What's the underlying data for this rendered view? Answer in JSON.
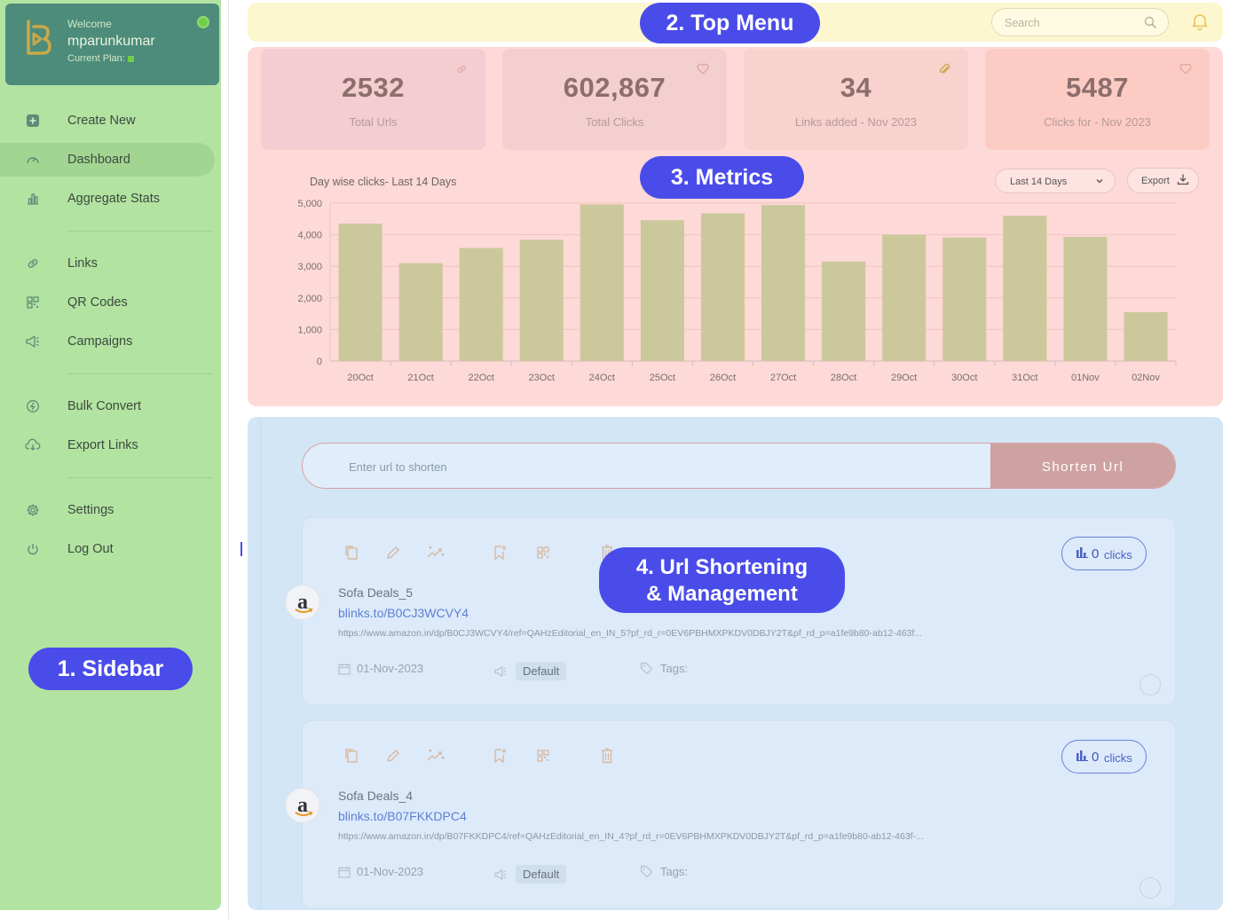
{
  "sidebar": {
    "welcome": "Welcome",
    "username": "mparunkumar",
    "plan_label": "Current Plan:",
    "items": [
      {
        "label": "Create New",
        "icon": "plus-square-icon"
      },
      {
        "label": "Dashboard",
        "icon": "dashboard-gauge-icon",
        "active": true
      },
      {
        "label": "Aggregate Stats",
        "icon": "bar-chart-icon"
      },
      {
        "label": "Links",
        "icon": "link-icon"
      },
      {
        "label": "QR Codes",
        "icon": "qr-code-icon"
      },
      {
        "label": "Campaigns",
        "icon": "megaphone-icon"
      },
      {
        "label": "Bulk Convert",
        "icon": "bulk-convert-icon"
      },
      {
        "label": "Export Links",
        "icon": "cloud-download-icon"
      },
      {
        "label": "Settings",
        "icon": "gear-icon"
      },
      {
        "label": "Log Out",
        "icon": "power-icon"
      }
    ]
  },
  "topbar": {
    "search_placeholder": "Search"
  },
  "stats": [
    {
      "value": "2532",
      "label": "Total Urls",
      "icon": "link-icon"
    },
    {
      "value": "602,867",
      "label": "Total Clicks",
      "icon": "heart-icon"
    },
    {
      "value": "34",
      "label": "Links added - Nov 2023",
      "icon": "paperclip-icon"
    },
    {
      "value": "5487",
      "label": "Clicks for - Nov 2023",
      "icon": "heart-icon"
    }
  ],
  "chart_controls": {
    "range": "Last 14 Days",
    "export": "Export"
  },
  "chart_data": {
    "type": "bar",
    "title": "Day wise clicks- Last 14 Days",
    "categories": [
      "20Oct",
      "21Oct",
      "22Oct",
      "23Oct",
      "24Oct",
      "25Oct",
      "26Oct",
      "27Oct",
      "28Oct",
      "29Oct",
      "30Oct",
      "31Oct",
      "01Nov",
      "02Nov"
    ],
    "values": [
      4350,
      3100,
      3580,
      3840,
      4960,
      4460,
      4680,
      4940,
      3150,
      4000,
      3910,
      4600,
      3930,
      1550
    ],
    "ylim": [
      0,
      5000
    ],
    "yticks": [
      "0",
      "1,000",
      "2,000",
      "3,000",
      "4,000",
      "5,000"
    ],
    "grid": true,
    "bar_color": "#cbc89b"
  },
  "shortener": {
    "placeholder": "Enter url to shorten",
    "button": "Shorten Url"
  },
  "links": [
    {
      "title": "Sofa Deals_5",
      "short_url": "blinks.to/B0CJ3WCVY4",
      "long_url": "https://www.amazon.in/dp/B0CJ3WCVY4/ref=QAHzEditorial_en_IN_5?pf_rd_r=0EV6PBHMXPKDV0DBJY2T&pf_rd_p=a1fe9b80-ab12-463f...",
      "clicks": "0",
      "clicks_word": "clicks",
      "date": "01-Nov-2023",
      "campaign": "Default",
      "tags": "Tags:"
    },
    {
      "title": "Sofa Deals_4",
      "short_url": "blinks.to/B07FKKDPC4",
      "long_url": "https://www.amazon.in/dp/B07FKKDPC4/ref=QAHzEditorial_en_IN_4?pf_rd_r=0EV6PBHMXPKDV0DBJY2T&pf_rd_p=a1fe9b80-ab12-463f-...",
      "clicks": "0",
      "clicks_word": "clicks",
      "date": "01-Nov-2023",
      "campaign": "Default",
      "tags": "Tags:"
    }
  ],
  "annotations": {
    "sidebar": "1. Sidebar",
    "top_menu": "2. Top Menu",
    "metrics": "3. Metrics",
    "url_line1": "4. Url Shortening",
    "url_line2": "& Management"
  },
  "colors": {
    "sidebar": "#b3e3a1",
    "topbar": "#fdf7cf",
    "metrics": "#fdd9d7",
    "url_panel": "#d3e6f6",
    "annotation": "#4a4cea"
  }
}
